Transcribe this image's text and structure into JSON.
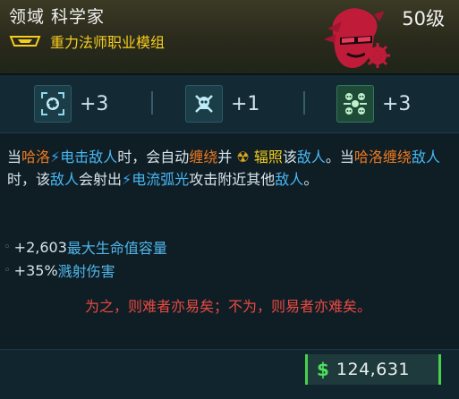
{
  "header": {
    "title": "领域 科学家",
    "level": "50级",
    "subtitle": "重力法师职业模组"
  },
  "cells": [
    {
      "icon": "target-vortex-icon",
      "value": "+3",
      "active": false
    },
    {
      "icon": "skull-crossbones-icon",
      "value": "+1",
      "active": false
    },
    {
      "icon": "skull-cluster-icon",
      "value": "+3",
      "active": true
    }
  ],
  "description": {
    "p1": "当",
    "p2": "哈洛",
    "p3": "电击",
    "p4": "敌人",
    "p5": "时，会自动",
    "p6": "缠绕",
    "p7": "并",
    "p8": "辐照",
    "p9": "该",
    "p10": "敌人",
    "p11": "。当",
    "p12": "哈洛缠绕",
    "p13": "敌人",
    "p14": "时，该",
    "p15": "敌人",
    "p16": "会射出",
    "p17": "电流弧光",
    "p18": "攻击附近其他",
    "p19": "敌人",
    "p20": "。"
  },
  "stats": [
    {
      "value": "+2,603",
      "name": "最大生命值容量"
    },
    {
      "value": "+35%",
      "name": "溅射伤害"
    }
  ],
  "quote": "为之，则难者亦易矣；不为，则易者亦难矣。",
  "footer": {
    "currency_symbol": "$",
    "price": "124,631"
  },
  "colors": {
    "orange": "#f07b1e",
    "blue": "#47b8f2",
    "yellow": "#f4cf1a",
    "quote_red": "#e84a42",
    "money_green": "#47d04c"
  }
}
